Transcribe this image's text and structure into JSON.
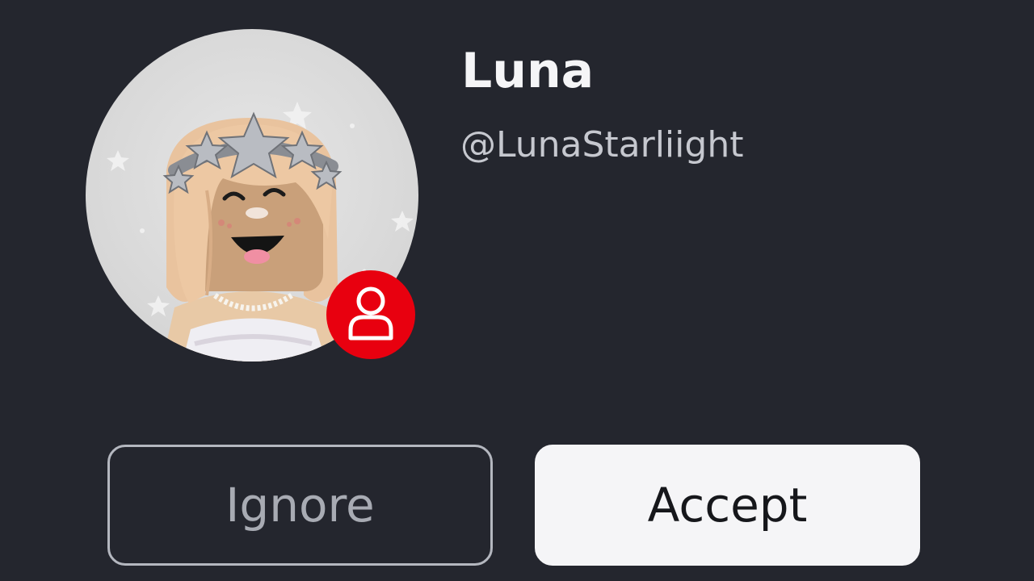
{
  "profile": {
    "display_name": "Luna",
    "username": "@LunaStarliight",
    "avatar_icon": "avatar-portrait",
    "badge_icon": "person-icon",
    "badge_color": "#e8000f"
  },
  "actions": {
    "ignore_label": "Ignore",
    "accept_label": "Accept"
  },
  "colors": {
    "background": "#24262e",
    "accept_bg": "#f5f5f7",
    "ignore_border": "#b4b7bf"
  }
}
